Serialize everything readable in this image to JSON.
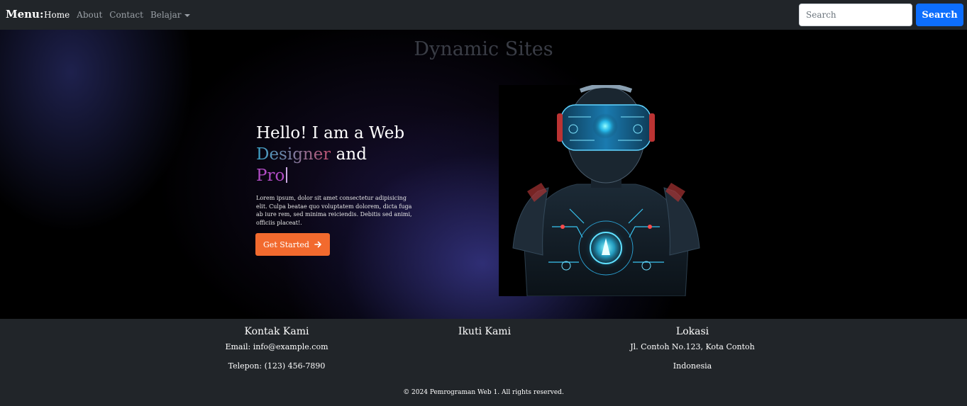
{
  "navbar": {
    "brand": "Menu:",
    "links": [
      {
        "label": "Home",
        "active": true
      },
      {
        "label": "About"
      },
      {
        "label": "Contact"
      },
      {
        "label": "Belajar",
        "dropdown": true
      }
    ],
    "search": {
      "placeholder": "Search",
      "value": ""
    },
    "search_button": "Search"
  },
  "hero": {
    "site_title": "Dynamic Sites",
    "headline_line1": "Hello! I am a Web",
    "headline_word1": "Designer",
    "headline_word2": " and",
    "headline_line3": "Pro",
    "description": "Lorem ipsum, dolor sit amet consectetur adipisicing elit. Culpa beatae quo voluptatem dolorem, dicta fuga ab iure rem, sed minima reiciendis. Debitis sed animi, officiis placeat!.",
    "cta_label": "Get Started",
    "cta_icon": "arrow-right-icon",
    "image_subject": "vr-headset-figure-illustration"
  },
  "footer": {
    "contact": {
      "title": "Kontak Kami",
      "email": "Email: info@example.com",
      "phone": "Telepon: (123) 456-7890"
    },
    "follow": {
      "title": "Ikuti Kami"
    },
    "location": {
      "title": "Lokasi",
      "address": "Jl. Contoh No.123, Kota Contoh",
      "country": "Indonesia"
    },
    "copyright": "© 2024 Pemrograman Web 1. All rights reserved."
  },
  "colors": {
    "navbar": "#212529",
    "primary": "#0d6efd",
    "cta": "#f26a2e",
    "pro_text": "#b04cc4"
  }
}
